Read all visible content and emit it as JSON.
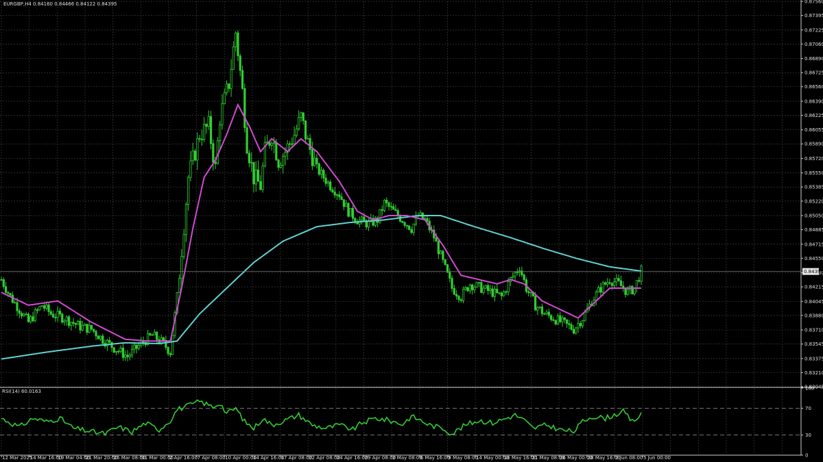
{
  "colors": {
    "background": "#000000",
    "grid": "#3c3c3c",
    "axis": "#cfcfcf",
    "text": "#e0e0e0",
    "candle": "#32cd32",
    "candle_fill": "#000000",
    "ma_fast": "#d24bd2",
    "ma_slow": "#5fd3d3",
    "rsi": "#32cd32",
    "rsi_levels": "#9a9a9a",
    "price_tag_bg": "#e6e6e6",
    "price_tag_text": "#000000"
  },
  "chart_data": {
    "type": "candlestick",
    "header": "EURGBP,H4  0.84160 0.84466 0.84122 0.84395",
    "symbol": "EURGBP,H4",
    "ohlc": "0.84160 0.84466 0.84122 0.84395",
    "last_price": "0.84395",
    "y_ticks": [
      "0.87560",
      "0.87395",
      "0.87225",
      "0.87060",
      "0.86890",
      "0.86725",
      "0.86560",
      "0.86390",
      "0.86225",
      "0.86055",
      "0.85890",
      "0.85720",
      "0.85550",
      "0.85385",
      "0.85220",
      "0.85050",
      "0.84885",
      "0.84715",
      "0.84550",
      "0.84380",
      "0.84215",
      "0.84045",
      "0.83880",
      "0.83710",
      "0.83545",
      "0.83375",
      "0.83210",
      "0.83045"
    ],
    "ylim": [
      0.83045,
      0.8756
    ],
    "x_ticks": [
      "12 Mar 2025",
      "14 Mar 16:00",
      "19 Mar 04:00",
      "21 Mar 20:00",
      "26 Mar 08:00",
      "31 Mar 00:00",
      "2 Apr 16:00",
      "7 Apr 08:00",
      "10 Apr 00:00",
      "14 Apr 16:00",
      "17 Apr 08:00",
      "22 Apr 08:00",
      "24 Apr 16:00",
      "29 Apr 08:00",
      "2 May 08:00",
      "6 May 16:00",
      "9 May 08:00",
      "14 May 00:00",
      "16 May 16:00",
      "21 May 08:00",
      "26 May 00:00",
      "28 May 16:00",
      "2 Jun 08:00",
      "5 Jun 00:00"
    ],
    "price_keyframes": [
      [
        0,
        0.843
      ],
      [
        4,
        0.841
      ],
      [
        8,
        0.8395
      ],
      [
        12,
        0.838
      ],
      [
        18,
        0.84
      ],
      [
        22,
        0.839
      ],
      [
        28,
        0.8385
      ],
      [
        35,
        0.8375
      ],
      [
        40,
        0.8372
      ],
      [
        45,
        0.836
      ],
      [
        50,
        0.835
      ],
      [
        56,
        0.834
      ],
      [
        62,
        0.8355
      ],
      [
        67,
        0.8365
      ],
      [
        72,
        0.8355
      ],
      [
        75,
        0.8345
      ],
      [
        78,
        0.841
      ],
      [
        83,
        0.855
      ],
      [
        88,
        0.86
      ],
      [
        92,
        0.861
      ],
      [
        95,
        0.856
      ],
      [
        97,
        0.862
      ],
      [
        101,
        0.866
      ],
      [
        104,
        0.872
      ],
      [
        107,
        0.865
      ],
      [
        109,
        0.859
      ],
      [
        112,
        0.855
      ],
      [
        115,
        0.854
      ],
      [
        117,
        0.858
      ],
      [
        120,
        0.86
      ],
      [
        123,
        0.857
      ],
      [
        126,
        0.858
      ],
      [
        130,
        0.86
      ],
      [
        133,
        0.862
      ],
      [
        136,
        0.859
      ],
      [
        140,
        0.856
      ],
      [
        146,
        0.854
      ],
      [
        150,
        0.853
      ],
      [
        154,
        0.851
      ],
      [
        158,
        0.85
      ],
      [
        163,
        0.8495
      ],
      [
        167,
        0.85
      ],
      [
        170,
        0.852
      ],
      [
        174,
        0.851
      ],
      [
        178,
        0.85
      ],
      [
        182,
        0.849
      ],
      [
        185,
        0.8505
      ],
      [
        188,
        0.85
      ],
      [
        192,
        0.848
      ],
      [
        196,
        0.845
      ],
      [
        200,
        0.842
      ],
      [
        204,
        0.841
      ],
      [
        208,
        0.8425
      ],
      [
        213,
        0.842
      ],
      [
        218,
        0.8415
      ],
      [
        222,
        0.841
      ],
      [
        226,
        0.843
      ],
      [
        230,
        0.8445
      ],
      [
        233,
        0.842
      ],
      [
        237,
        0.84
      ],
      [
        241,
        0.839
      ],
      [
        245,
        0.8385
      ],
      [
        250,
        0.8378
      ],
      [
        254,
        0.8372
      ],
      [
        258,
        0.8385
      ],
      [
        262,
        0.8405
      ],
      [
        266,
        0.842
      ],
      [
        270,
        0.843
      ],
      [
        274,
        0.8425
      ],
      [
        278,
        0.8415
      ],
      [
        281,
        0.842
      ],
      [
        284,
        0.844
      ]
    ],
    "ma_fast": {
      "color": "#d24bd2",
      "values": [
        [
          0,
          0.8415
        ],
        [
          12,
          0.84
        ],
        [
          25,
          0.8405
        ],
        [
          40,
          0.838
        ],
        [
          55,
          0.836
        ],
        [
          65,
          0.8358
        ],
        [
          75,
          0.8358
        ],
        [
          80,
          0.842
        ],
        [
          85,
          0.849
        ],
        [
          90,
          0.855
        ],
        [
          95,
          0.857
        ],
        [
          100,
          0.86
        ],
        [
          105,
          0.8635
        ],
        [
          110,
          0.861
        ],
        [
          115,
          0.858
        ],
        [
          120,
          0.8595
        ],
        [
          127,
          0.858
        ],
        [
          133,
          0.8595
        ],
        [
          140,
          0.858
        ],
        [
          150,
          0.8545
        ],
        [
          158,
          0.851
        ],
        [
          165,
          0.85
        ],
        [
          172,
          0.8505
        ],
        [
          180,
          0.8505
        ],
        [
          188,
          0.85
        ],
        [
          196,
          0.847
        ],
        [
          204,
          0.8435
        ],
        [
          212,
          0.843
        ],
        [
          220,
          0.8425
        ],
        [
          226,
          0.843
        ],
        [
          232,
          0.8425
        ],
        [
          240,
          0.8405
        ],
        [
          248,
          0.8395
        ],
        [
          256,
          0.8385
        ],
        [
          262,
          0.84
        ],
        [
          270,
          0.842
        ],
        [
          276,
          0.842
        ],
        [
          282,
          0.842
        ]
      ]
    },
    "ma_slow": {
      "color": "#5fd3d3",
      "values": [
        [
          0,
          0.8337
        ],
        [
          20,
          0.8345
        ],
        [
          40,
          0.8352
        ],
        [
          55,
          0.8356
        ],
        [
          70,
          0.8355
        ],
        [
          78,
          0.8358
        ],
        [
          88,
          0.839
        ],
        [
          100,
          0.842
        ],
        [
          112,
          0.845
        ],
        [
          125,
          0.8475
        ],
        [
          140,
          0.8492
        ],
        [
          155,
          0.8497
        ],
        [
          170,
          0.85
        ],
        [
          185,
          0.8505
        ],
        [
          195,
          0.8505
        ],
        [
          210,
          0.8492
        ],
        [
          225,
          0.848
        ],
        [
          240,
          0.8467
        ],
        [
          255,
          0.8455
        ],
        [
          270,
          0.8445
        ],
        [
          284,
          0.844
        ]
      ]
    },
    "rsi": {
      "label": "RSI(14) 60.0163",
      "levels": [
        30,
        70
      ],
      "range": [
        0,
        100
      ],
      "ticks": [
        "100",
        "70",
        "30",
        "0"
      ],
      "keyframes": [
        [
          0,
          55
        ],
        [
          8,
          42
        ],
        [
          14,
          55
        ],
        [
          20,
          50
        ],
        [
          26,
          55
        ],
        [
          32,
          40
        ],
        [
          40,
          35
        ],
        [
          46,
          32
        ],
        [
          52,
          42
        ],
        [
          58,
          35
        ],
        [
          64,
          48
        ],
        [
          70,
          38
        ],
        [
          75,
          52
        ],
        [
          78,
          68
        ],
        [
          84,
          75
        ],
        [
          88,
          80
        ],
        [
          94,
          72
        ],
        [
          97,
          78
        ],
        [
          100,
          62
        ],
        [
          104,
          70
        ],
        [
          108,
          50
        ],
        [
          112,
          40
        ],
        [
          116,
          55
        ],
        [
          120,
          45
        ],
        [
          126,
          52
        ],
        [
          132,
          60
        ],
        [
          138,
          45
        ],
        [
          144,
          40
        ],
        [
          150,
          45
        ],
        [
          156,
          38
        ],
        [
          160,
          48
        ],
        [
          166,
          55
        ],
        [
          172,
          52
        ],
        [
          178,
          46
        ],
        [
          182,
          58
        ],
        [
          186,
          52
        ],
        [
          190,
          45
        ],
        [
          196,
          40
        ],
        [
          200,
          32
        ],
        [
          206,
          45
        ],
        [
          212,
          52
        ],
        [
          218,
          48
        ],
        [
          224,
          55
        ],
        [
          228,
          60
        ],
        [
          232,
          52
        ],
        [
          236,
          40
        ],
        [
          242,
          45
        ],
        [
          248,
          38
        ],
        [
          254,
          35
        ],
        [
          258,
          50
        ],
        [
          262,
          58
        ],
        [
          268,
          55
        ],
        [
          272,
          60
        ],
        [
          276,
          65
        ],
        [
          280,
          50
        ],
        [
          284,
          60
        ]
      ]
    }
  }
}
